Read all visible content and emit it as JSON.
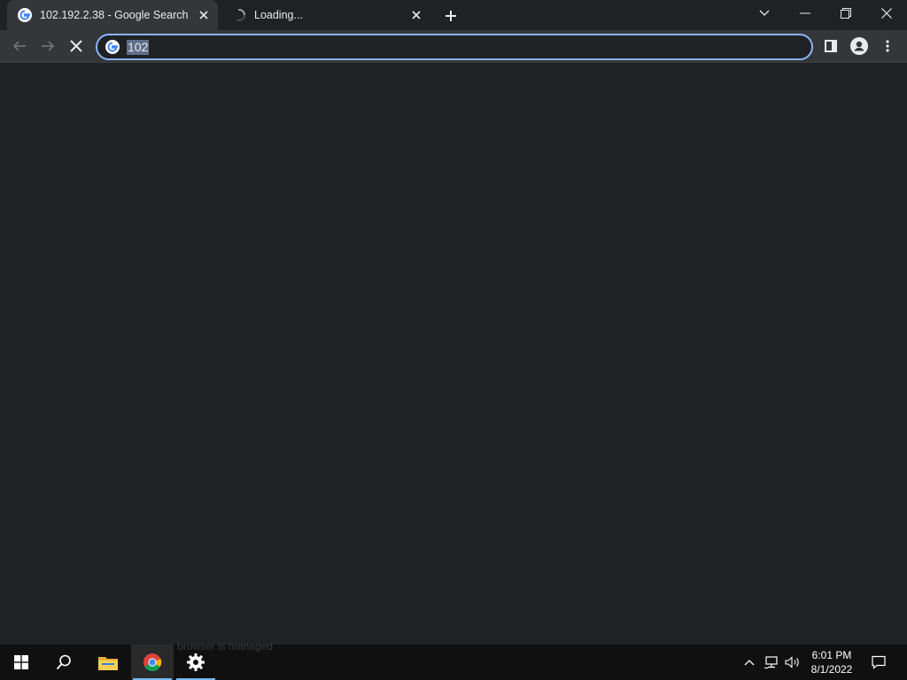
{
  "tabs": [
    {
      "title": "102.192.2.38 - Google Search",
      "active": true
    },
    {
      "title": "Loading...",
      "active": false
    }
  ],
  "omnibox": {
    "value": "102"
  },
  "taskbar": {
    "ghost_text": "browser is managed",
    "clock": {
      "time": "6:01 PM",
      "date": "8/1/2022"
    }
  },
  "colors": {
    "accent": "#8ab4f8",
    "page_bg": "#202124",
    "toolbar_bg": "#35363a",
    "taskbar_bg": "#101010"
  }
}
